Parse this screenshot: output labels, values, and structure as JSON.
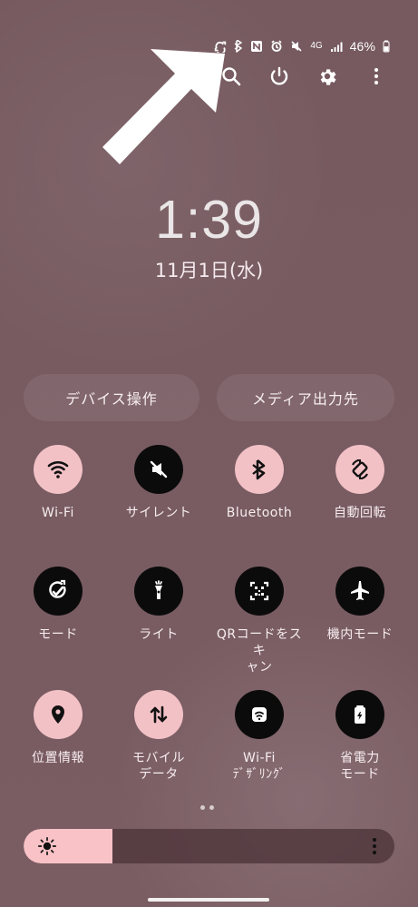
{
  "status_bar": {
    "network_label": "4G",
    "battery_text": "46%",
    "icons": [
      "sync-icon",
      "bluetooth-icon",
      "nfc-icon",
      "alarm-icon",
      "mute-icon",
      "network-icon",
      "signal-icon",
      "battery-icon"
    ]
  },
  "annotation": {
    "arrow_color": "#ffffff",
    "arrow_icon": "arrow-up-right-icon"
  },
  "top_actions": [
    {
      "name": "search",
      "icon": "search-icon"
    },
    {
      "name": "power",
      "icon": "power-icon"
    },
    {
      "name": "settings",
      "icon": "gear-icon"
    },
    {
      "name": "more",
      "icon": "more-vert-icon"
    }
  ],
  "clock": {
    "time": "1:39",
    "date": "11月1日(水)"
  },
  "shortcuts": {
    "device_control": "デバイス操作",
    "media_output": "メディア出力先"
  },
  "tiles": [
    {
      "label": "Wi-Fi",
      "active": true,
      "icon": "wifi-icon"
    },
    {
      "label": "サイレント",
      "active": false,
      "icon": "silent-icon"
    },
    {
      "label": "Bluetooth",
      "active": true,
      "icon": "bluetooth-icon"
    },
    {
      "label": "自動回転",
      "active": true,
      "icon": "auto-rotate-icon"
    },
    {
      "label": "モード",
      "active": false,
      "icon": "mode-icon"
    },
    {
      "label": "ライト",
      "active": false,
      "icon": "flashlight-icon"
    },
    {
      "label": "QRコードをスキ\nャン",
      "active": false,
      "icon": "qr-icon"
    },
    {
      "label": "機内モード",
      "active": false,
      "icon": "airplane-icon"
    },
    {
      "label": "位置情報",
      "active": true,
      "icon": "location-icon"
    },
    {
      "label": "モバイル\nデータ",
      "active": true,
      "icon": "mobile-data-icon"
    },
    {
      "label": "Wi-Fi\nﾃﾞｻﾞﾘﾝｸﾞ",
      "active": false,
      "icon": "wifi-tethering-icon"
    },
    {
      "label": "省電力\nモード",
      "active": false,
      "icon": "battery-saver-icon"
    }
  ],
  "brightness": {
    "level": 0.24,
    "fill_color": "#f8c2c6",
    "track_color": "#4f373c"
  },
  "colors": {
    "background": "#775b61",
    "tile_active": "#f2c1c6",
    "tile_inactive": "#0c0b0c",
    "text": "#f7edf0"
  }
}
